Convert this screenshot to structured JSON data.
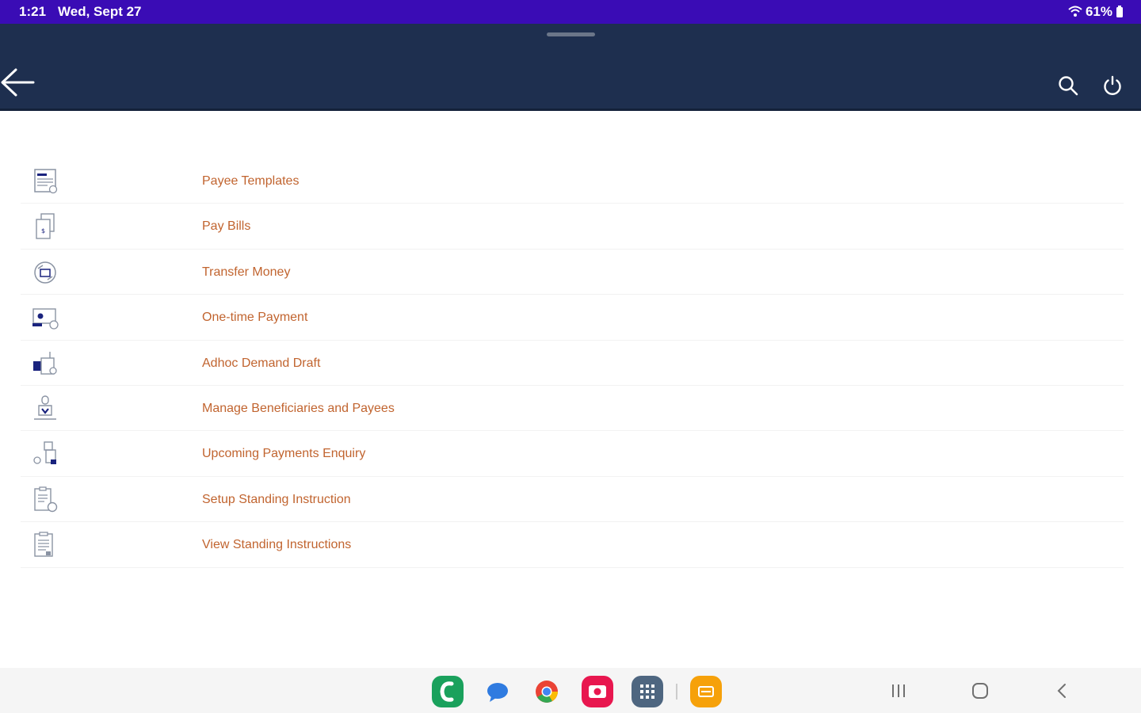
{
  "status_bar": {
    "time": "1:21",
    "date": "Wed, Sept 27",
    "battery": "61%",
    "background_color": "#3a0cb5"
  },
  "header": {
    "background_color": "#1e2f4f",
    "back_icon": "arrow-left-icon",
    "search_icon": "search-icon",
    "power_icon": "power-icon"
  },
  "menu": {
    "label_color": "#c1642f",
    "items": [
      {
        "label": "Payee Templates",
        "icon": "payee-templates-icon"
      },
      {
        "label": "Pay Bills",
        "icon": "pay-bills-icon"
      },
      {
        "label": "Transfer Money",
        "icon": "transfer-money-icon"
      },
      {
        "label": "One-time Payment",
        "icon": "one-time-payment-icon"
      },
      {
        "label": "Adhoc Demand Draft",
        "icon": "demand-draft-icon"
      },
      {
        "label": "Manage Beneficiaries and Payees",
        "icon": "beneficiaries-icon"
      },
      {
        "label": "Upcoming Payments Enquiry",
        "icon": "upcoming-payments-icon"
      },
      {
        "label": "Setup Standing Instruction",
        "icon": "setup-standing-instruction-icon"
      },
      {
        "label": "View Standing Instructions",
        "icon": "view-standing-instructions-icon"
      }
    ]
  },
  "dock": {
    "apps": [
      {
        "icon": "phone-app-icon",
        "color": "#1aa15c"
      },
      {
        "icon": "messages-app-icon",
        "color": "#2f7be0"
      },
      {
        "icon": "chrome-app-icon",
        "color": "#ea4335"
      },
      {
        "icon": "camera-app-icon",
        "color": "#e8174f"
      },
      {
        "icon": "app-drawer-icon",
        "color": "#4e6680"
      },
      {
        "icon": "bank-app-icon",
        "color": "#f6a10a"
      }
    ],
    "system_buttons": [
      "recents-icon",
      "home-icon",
      "back-nav-icon"
    ]
  }
}
